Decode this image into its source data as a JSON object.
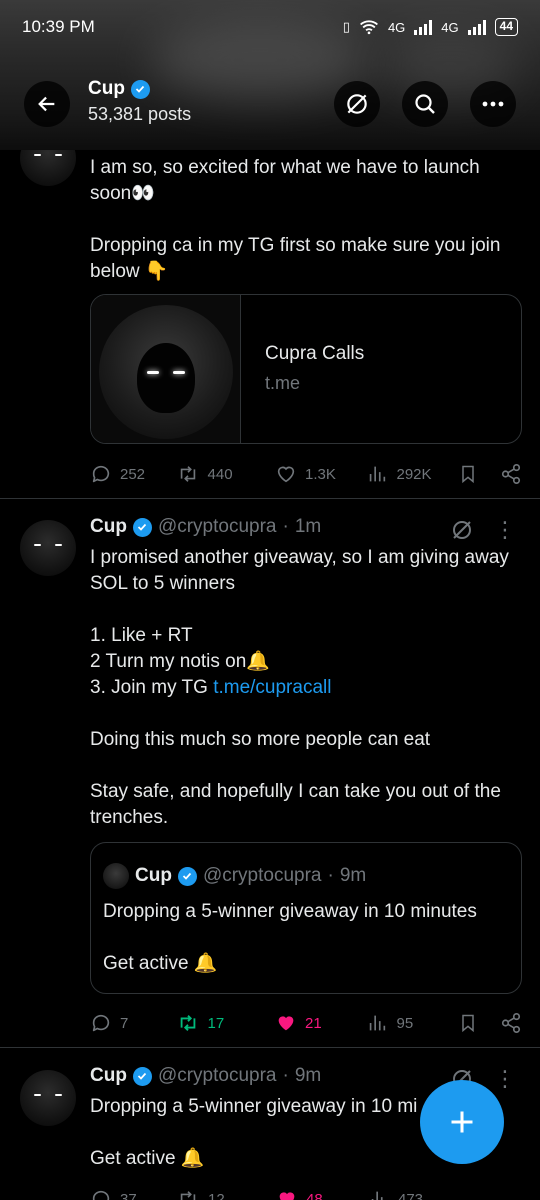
{
  "status_bar": {
    "time": "10:39 PM",
    "network1": "4G",
    "network2": "4G",
    "battery": "44"
  },
  "header": {
    "name": "Cup",
    "posts": "53,381 posts"
  },
  "tweets": [
    {
      "text_line1": "I am so, so excited for what we have to launch soon👀",
      "text_line2": "Dropping ca in my TG first so make sure you join below 👇",
      "card": {
        "title": "Cupra Calls",
        "domain": "t.me"
      },
      "replies": "252",
      "reposts": "440",
      "likes": "1.3K",
      "views": "292K"
    },
    {
      "name": "Cup",
      "handle": "@cryptocupra",
      "dot": "·",
      "time": "1m",
      "text_a": "I promised another giveaway, so I am giving away SOL to 5 winners\n\n1. Like + RT\n2 Turn my notis on🔔\n3. Join my TG ",
      "link": "t.me/cupracall",
      "text_b": "Doing this much so more people can eat\n\nStay safe, and hopefully I can take you out of the trenches.",
      "quote": {
        "name": "Cup",
        "handle": "@cryptocupra",
        "dot": "·",
        "time": "9m",
        "text": "Dropping a 5-winner giveaway in 10 minutes\n\nGet active 🔔"
      },
      "replies": "7",
      "reposts": "17",
      "likes": "21",
      "views": "95"
    },
    {
      "name": "Cup",
      "handle": "@cryptocupra",
      "dot": "·",
      "time": "9m",
      "text": "Dropping a 5-winner giveaway in 10 mi\n\nGet active 🔔",
      "replies": "37",
      "reposts": "12",
      "likes": "48",
      "views": "473"
    }
  ],
  "colors": {
    "accent": "#1d9bf0",
    "repost_active": "#00ba7c",
    "like_active": "#f91880"
  }
}
